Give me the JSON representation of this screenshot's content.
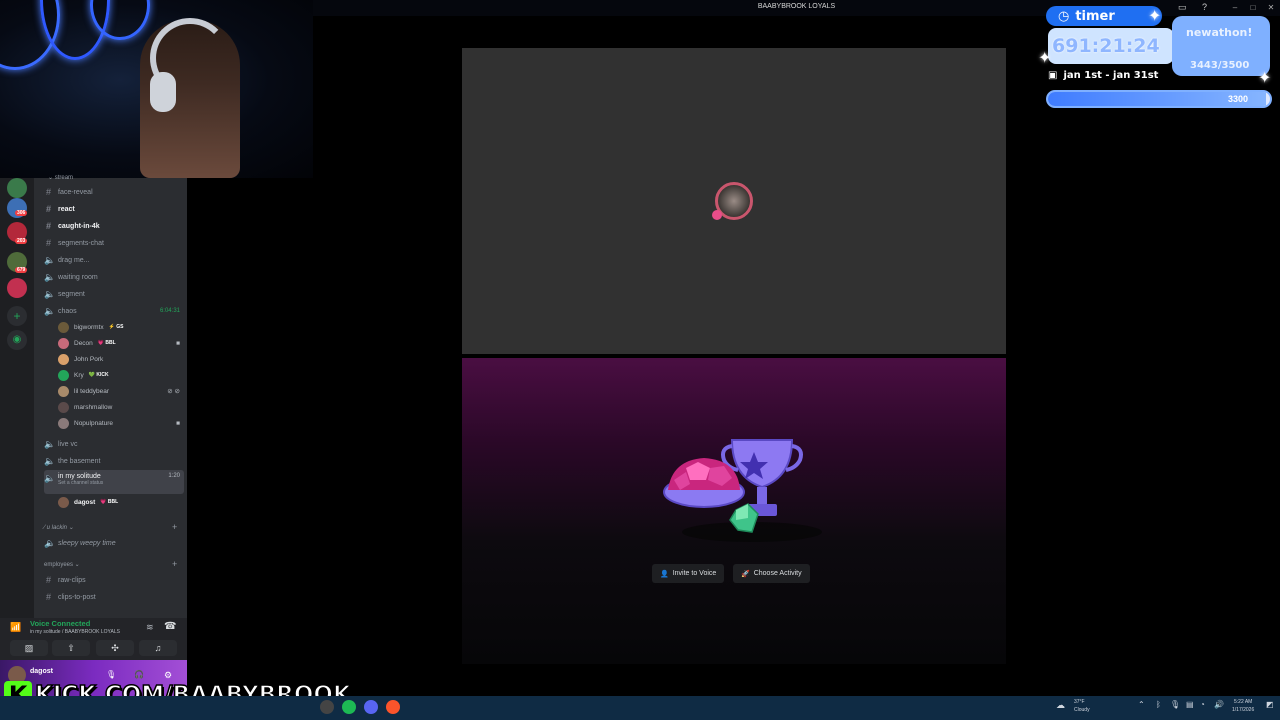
{
  "window": {
    "title": "BAABYBROOK LOYALS"
  },
  "sidebar": {
    "top_category": "stream",
    "channels": [
      {
        "name": "face-reveal",
        "type": "text",
        "bold": false
      },
      {
        "name": "react",
        "type": "text",
        "bold": true
      },
      {
        "name": "caught-in-4k",
        "type": "text",
        "bold": true
      },
      {
        "name": "segments-chat",
        "type": "text",
        "bold": false
      },
      {
        "name": "drag me...",
        "type": "voice",
        "bold": false
      },
      {
        "name": "waiting room",
        "type": "voice",
        "bold": false
      },
      {
        "name": "segment",
        "type": "voice",
        "bold": false
      },
      {
        "name": "chaos",
        "type": "voice",
        "bold": false,
        "timer": "6:04:31"
      }
    ],
    "chaos_members": [
      {
        "name": "bigwormtx",
        "tag": "⚡ GS"
      },
      {
        "name": "Decon",
        "tag": "💗 BBL"
      },
      {
        "name": "John Pork",
        "tag": ""
      },
      {
        "name": "Kry",
        "tag": "💚 KICK"
      },
      {
        "name": "lil teddybear",
        "tag": ""
      },
      {
        "name": "marshmallow",
        "tag": ""
      },
      {
        "name": "Nopulpnature",
        "tag": ""
      }
    ],
    "channels2": [
      {
        "name": "live vc"
      },
      {
        "name": "the basement"
      }
    ],
    "active_channel": {
      "name": "in my solitude",
      "status": "Set a channel status",
      "timer": "1:20"
    },
    "active_member": {
      "name": "dagost",
      "tag": "💗 BBL"
    },
    "category_ulackin": "u lackin",
    "sleepy": "sleepy weepy time",
    "category_employees": "employees",
    "channels3": [
      {
        "name": "raw-clips"
      },
      {
        "name": "clips-to-post"
      }
    ],
    "guild_badges": [
      "306",
      "203",
      "679"
    ]
  },
  "voice": {
    "status": "Voice Connected",
    "location": "in my solitude / BAABYBROOK LOYALS"
  },
  "user": {
    "name": "dagost"
  },
  "stage": {
    "invite_label": "Invite to Voice",
    "activity_label": "Choose Activity"
  },
  "overlay": {
    "timer_label": "timer",
    "timer_value": "691:21:24",
    "subathon_label": "newathon!",
    "subathon_count": "3443/3500",
    "dates": "jan 1st - jan 31st",
    "progress_right": "3300",
    "progress_fraction": 0.98
  },
  "kick": {
    "logo": "K",
    "url": "KICK.COM/BAABYBROOK"
  },
  "taskbar": {
    "weather_temp": "37°F",
    "weather_desc": "Cloudy",
    "time": "5:22 AM",
    "date": "1/17/2026"
  },
  "colors": {
    "discord_blurple": "#5865f2",
    "voice_green": "#23a55a",
    "kick_green": "#53fc18",
    "overlay_blue": "#1f6ff2"
  }
}
